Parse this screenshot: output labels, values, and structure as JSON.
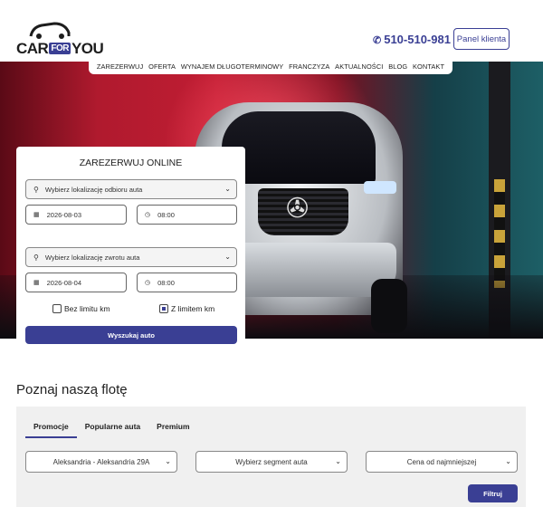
{
  "brand": {
    "logo_text_prefix": "CAR",
    "logo_text_mid": "FOR",
    "logo_text_suffix": "YOU",
    "accent_color": "#3a3f94"
  },
  "header": {
    "phone": "510-510-981",
    "phone_icon": "phone-icon",
    "panel_button": "Panel klienta"
  },
  "nav": {
    "items": [
      {
        "label": "ZAREZERWUJ"
      },
      {
        "label": "OFERTA"
      },
      {
        "label": "WYNAJEM DŁUGOTERMINOWY"
      },
      {
        "label": "FRANCZYZA"
      },
      {
        "label": "AKTUALNOŚCI"
      },
      {
        "label": "BLOG"
      },
      {
        "label": "KONTAKT"
      }
    ]
  },
  "booking": {
    "title": "ZAREZERWUJ ONLINE",
    "pickup_location_placeholder": "Wybierz lokalizację odbioru auta",
    "pickup_date": "2026-08-03",
    "pickup_time": "08:00",
    "return_location_placeholder": "Wybierz lokalizację zwrotu auta",
    "return_date": "2026-08-04",
    "return_time": "08:00",
    "no_limit_label": "Bez limitu km",
    "no_limit_checked": false,
    "with_limit_label": "Z limitem km",
    "with_limit_checked": true,
    "search_button": "Wyszukaj auto"
  },
  "fleet": {
    "title": "Poznaj naszą flotę",
    "tabs": [
      {
        "label": "Promocje",
        "active": true
      },
      {
        "label": "Popularne auta",
        "active": false
      },
      {
        "label": "Premium",
        "active": false
      }
    ],
    "location_select": "Aleksandria - Aleksandria 29A",
    "segment_select": "Wybierz segment auta",
    "sort_select": "Cena od najmniejszej",
    "filter_button": "Filtruj"
  }
}
